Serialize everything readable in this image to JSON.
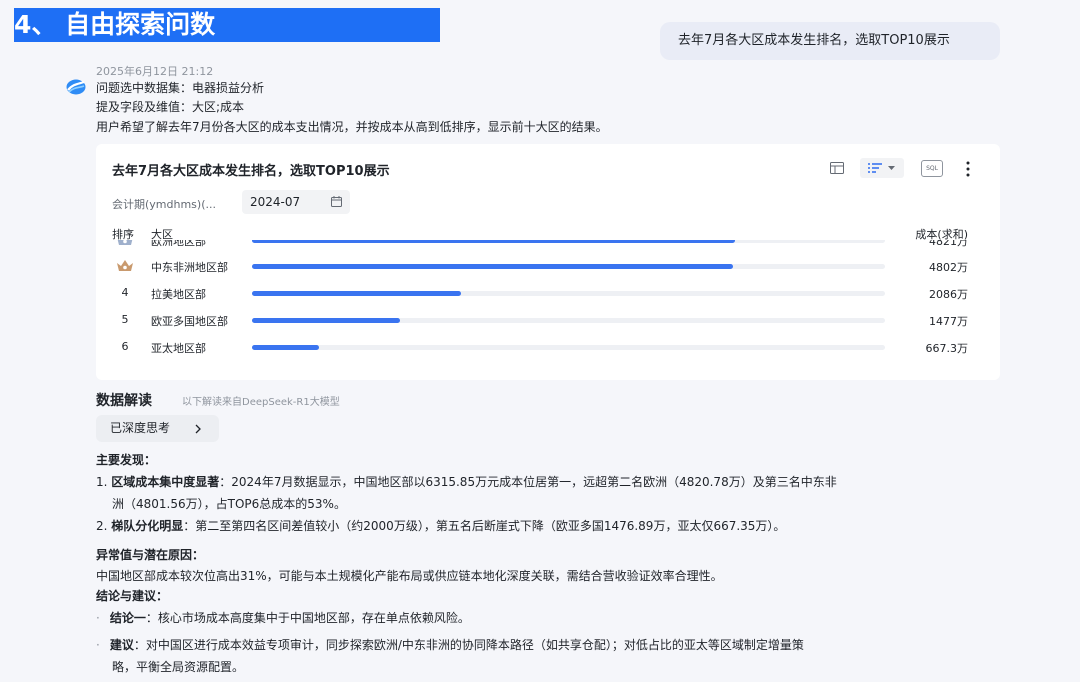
{
  "header": {
    "banner_title": "4、 自由探索问数"
  },
  "user_query": "去年7月各大区成本发生排名，选取TOP10展示",
  "bot": {
    "timestamp": "2025年6月12日 21:12",
    "dataset_line": "问题选中数据集：电器损益分析",
    "fields_line": "提及字段及维值：大区;成本",
    "intent_line": "用户希望了解去年7月份各大区的成本支出情况，并按成本从高到低排序，显示前十大区的结果。"
  },
  "card": {
    "title": "去年7月各大区成本发生排名，选取TOP10展示",
    "sql_label": "SQL",
    "filter_label": "会计期(ymdhms)(...",
    "filter_value": "2024-07",
    "col_rank": "排序",
    "col_region": "大区",
    "col_cost": "成本(求和)"
  },
  "chart_data": {
    "type": "bar",
    "orientation": "horizontal",
    "categories": [
      "欧洲地区部",
      "中东非洲地区部",
      "拉美地区部",
      "欧亚多国地区部",
      "亚太地区部"
    ],
    "ranks": [
      "",
      "",
      "4",
      "5",
      "6"
    ],
    "value_labels": [
      "4821万",
      "4802万",
      "2086万",
      "1477万",
      "667.3万"
    ],
    "values": [
      4821,
      4802,
      2086,
      1477,
      667.3
    ],
    "xlim": [
      0,
      6315.85
    ],
    "colors": {
      "bar": "#3a74f0",
      "track": "#eef0f4"
    }
  },
  "analysis": {
    "title": "数据解读",
    "subtitle": "以下解读来自DeepSeek-R1大模型",
    "think_button": "已深度思考",
    "findings_title": "主要发现：",
    "f1_prefix": "1. ",
    "f1_bold": "区域成本集中度显著",
    "f1_text_a": "：2024年7月数据显示，中国地区部以6315.85万元成本位居第一，远超第二名欧洲（4820.78万）及第三名中东非",
    "f1_text_b": "洲（4801.56万），占TOP6总成本的53%。",
    "f2_prefix": "2. ",
    "f2_bold": "梯队分化明显",
    "f2_text": "：第二至第四名区间差值较小（约2000万级），第五名后断崖式下降（欧亚多国1476.89万，亚太仅667.35万）。",
    "anomaly_title": "异常值与潜在原因：",
    "anomaly_text": "中国地区部成本较次位高出31%，可能与本土规模化产能布局或供应链本地化深度关联，需结合营收验证效率合理性。",
    "conclusion_title": "结论与建议：",
    "c1_bold": "结论一",
    "c1_text": "：核心市场成本高度集中于中国地区部，存在单点依赖风险。",
    "c2_bold": "建议",
    "c2_text_a": "：对中国区进行成本效益专项审计，同步探索欧洲/中东非洲的协同降本路径（如共享仓配）；对低占比的亚太等区域制定增量策",
    "c2_text_b": "略，平衡全局资源配置。"
  },
  "icons": [
    "bot-avatar-icon",
    "table-view-icon",
    "sort-list-icon",
    "chevron-down-icon",
    "sql-icon",
    "more-vertical-icon",
    "calendar-icon",
    "crown-medal-icon",
    "chevron-right-icon"
  ]
}
